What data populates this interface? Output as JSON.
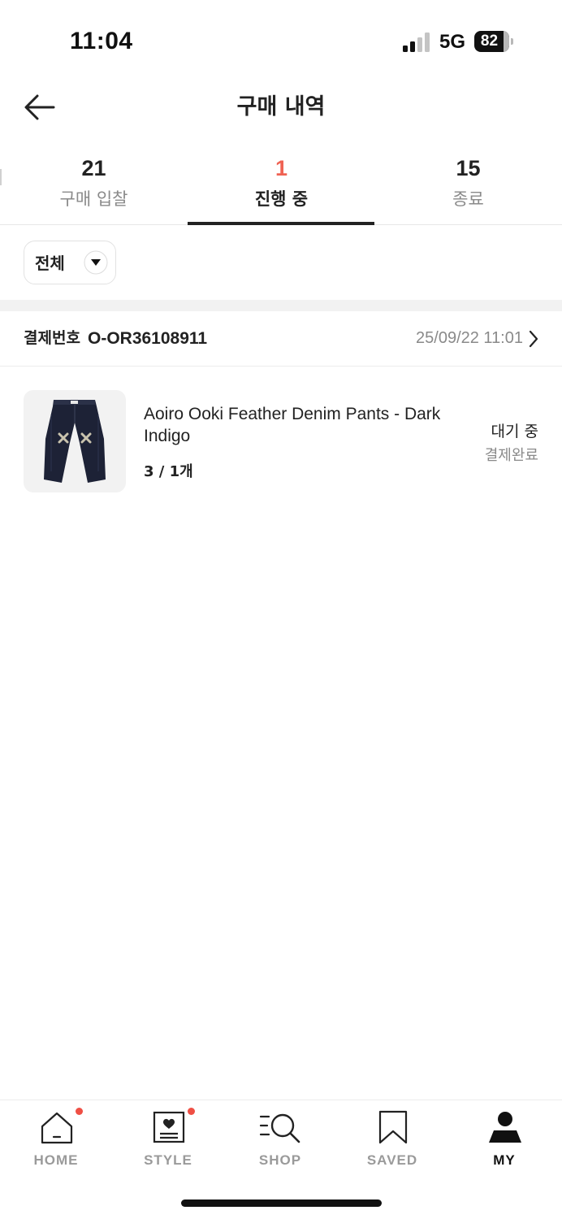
{
  "status_bar": {
    "time": "11:04",
    "network": "5G",
    "battery": "82"
  },
  "header": {
    "title": "구매 내역",
    "back_icon": "arrow-left-icon"
  },
  "tabs": [
    {
      "count": "21",
      "label": "구매 입찰",
      "active": false
    },
    {
      "count": "1",
      "label": "진행 중",
      "active": true
    },
    {
      "count": "15",
      "label": "종료",
      "active": false
    }
  ],
  "filter": {
    "selected": "전체",
    "icon": "caret-down-icon"
  },
  "order": {
    "number_label": "결제번호",
    "number": "O-OR36108911",
    "date": "25/09/22 11:01",
    "item": {
      "name": "Aoiro Ooki Feather Denim Pants - Dark Indigo",
      "quantity": "3 / 1개",
      "status": "대기 중",
      "sub_status": "결제완료"
    }
  },
  "bottom_nav": {
    "items": [
      {
        "label": "HOME",
        "icon": "home-icon",
        "dot": true,
        "active": false
      },
      {
        "label": "STYLE",
        "icon": "style-icon",
        "dot": true,
        "active": false
      },
      {
        "label": "SHOP",
        "icon": "shop-search-icon",
        "dot": false,
        "active": false
      },
      {
        "label": "SAVED",
        "icon": "bookmark-icon",
        "dot": false,
        "active": false
      },
      {
        "label": "MY",
        "icon": "profile-icon",
        "dot": false,
        "active": true
      }
    ]
  },
  "colors": {
    "accent": "#ef6253",
    "notification_dot": "#ef4f44",
    "text_primary": "#222222",
    "text_secondary": "#8a8a8a"
  }
}
